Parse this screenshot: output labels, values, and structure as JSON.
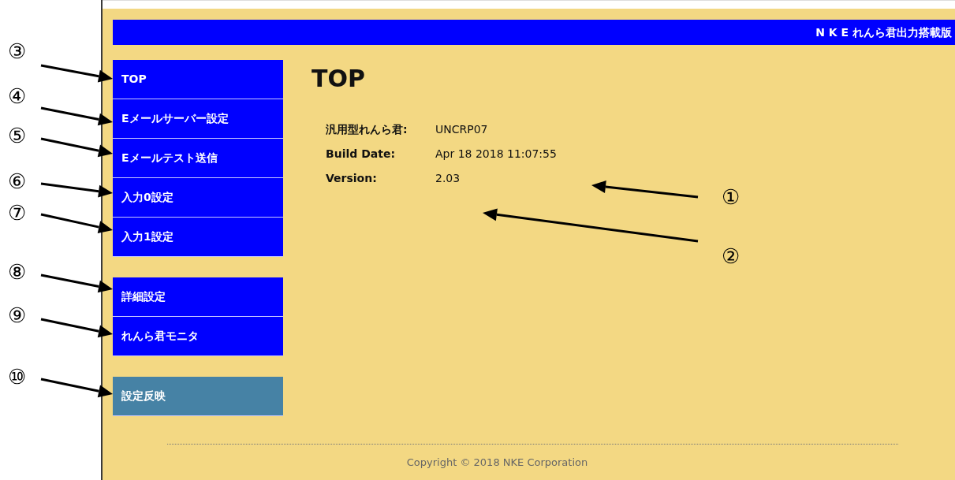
{
  "header": {
    "title": "N K E れんら君出力搭載版"
  },
  "sidebar": {
    "groups": [
      {
        "items": [
          {
            "label": "TOP",
            "kind": "nav"
          },
          {
            "label": "Eメールサーバー設定",
            "kind": "nav"
          },
          {
            "label": "Eメールテスト送信",
            "kind": "nav"
          },
          {
            "label": "入力0設定",
            "kind": "nav"
          },
          {
            "label": "入力1設定",
            "kind": "nav"
          }
        ]
      },
      {
        "items": [
          {
            "label": "詳細設定",
            "kind": "nav"
          },
          {
            "label": "れんら君モニタ",
            "kind": "nav"
          }
        ]
      },
      {
        "items": [
          {
            "label": "設定反映",
            "kind": "action"
          }
        ]
      }
    ]
  },
  "content": {
    "heading": "TOP",
    "info": [
      {
        "label": "汎用型れんら君:",
        "value": "UNCRP07"
      },
      {
        "label": "Build Date:",
        "value": "Apr 18 2018 11:07:55"
      },
      {
        "label": "Version:",
        "value": "2.03"
      }
    ]
  },
  "footer": {
    "copyright": "Copyright © 2018 NKE Corporation"
  },
  "callouts": [
    {
      "label": "①"
    },
    {
      "label": "②"
    },
    {
      "label": "③"
    },
    {
      "label": "④"
    },
    {
      "label": "⑤"
    },
    {
      "label": "⑥"
    },
    {
      "label": "⑦"
    },
    {
      "label": "⑧"
    },
    {
      "label": "⑨"
    },
    {
      "label": "⑩"
    }
  ]
}
